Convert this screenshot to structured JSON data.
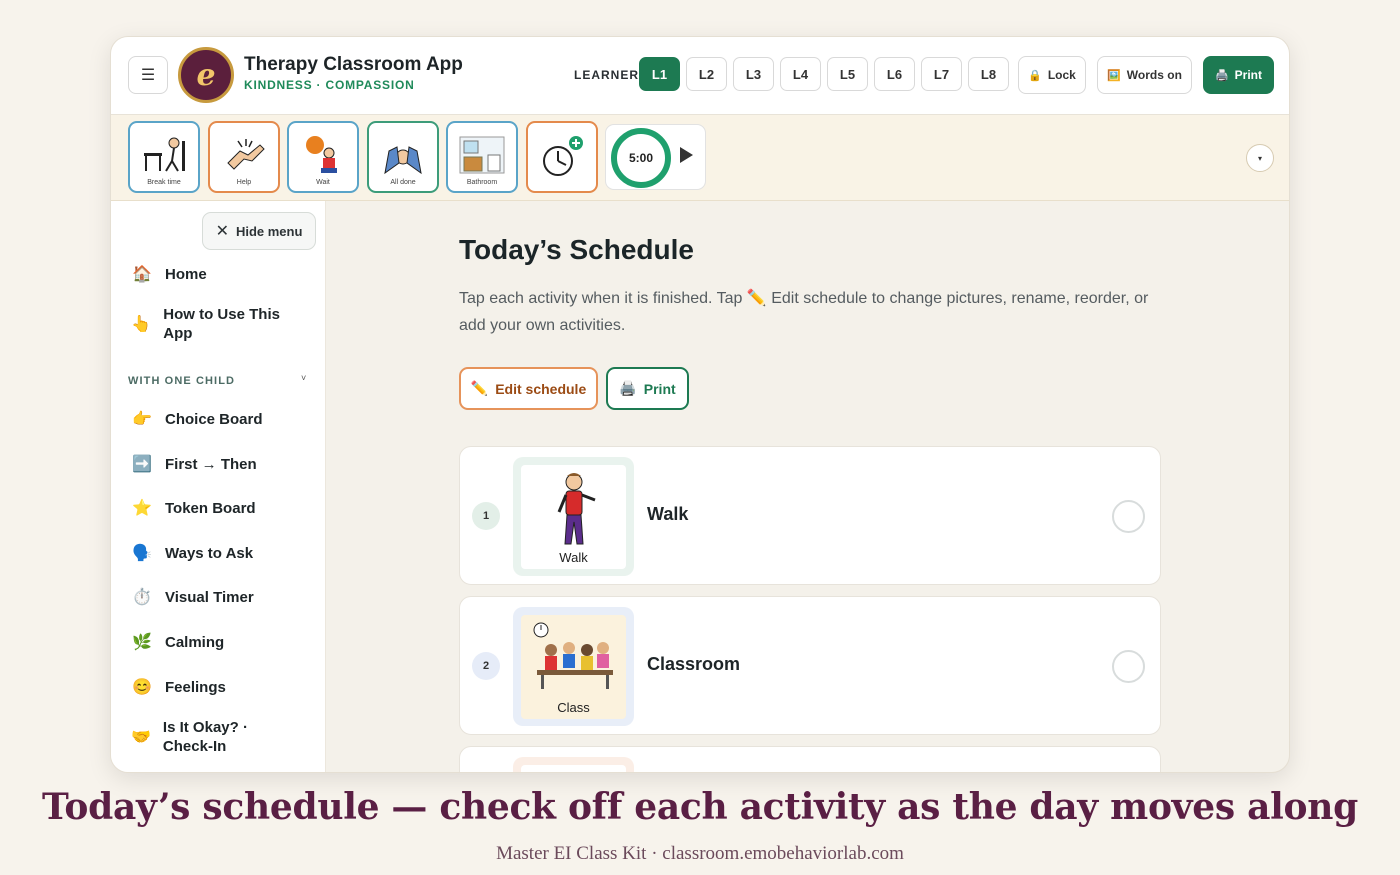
{
  "header": {
    "menu_icon": "hamburger-icon",
    "logo_letter": "e",
    "title": "Therapy Classroom App",
    "subtitle": "KINDNESS · COMPASSION",
    "learner_label": "LEARNER",
    "learners": [
      "L1",
      "L2",
      "L3",
      "L4",
      "L5",
      "L6",
      "L7",
      "L8"
    ],
    "active_learner": "L1",
    "lock_label": "Lock",
    "words_label": "Words on",
    "print_label": "Print",
    "colors": {
      "accent": "#1d7a52",
      "brand": "#5b1f3c"
    }
  },
  "quick_strip": {
    "tiles": [
      "Break time",
      "Help",
      "Wait",
      "All done",
      "Bathroom"
    ],
    "add_timer_icon": "clock-plus-icon",
    "timer_value": "5:00",
    "play_icon": "play-icon",
    "toggle_icon": "chevron-down-icon"
  },
  "sidebar": {
    "hide_menu": "Hide menu",
    "top_items": [
      {
        "icon": "🏠",
        "label": "Home"
      },
      {
        "icon": "👆",
        "label": "How to Use This App"
      }
    ],
    "section": "WITH ONE CHILD",
    "section_chevron": "˅",
    "items": [
      {
        "icon": "👉",
        "label": "Choice Board"
      },
      {
        "icon": "➡️",
        "label": "First → Then"
      },
      {
        "icon": "⭐",
        "label": "Token Board"
      },
      {
        "icon": "🗣️",
        "label": "Ways to Ask"
      },
      {
        "icon": "⏱️",
        "label": "Visual Timer"
      },
      {
        "icon": "🌿",
        "label": "Calming"
      },
      {
        "icon": "😊",
        "label": "Feelings"
      },
      {
        "icon": "🤝",
        "label": "Is It Okay? · Check-In"
      }
    ]
  },
  "main": {
    "title": "Today’s Schedule",
    "description": "Tap each activity when it is finished. Tap ✏️ Edit schedule to change pictures, rename, reorder, or add your own activities.",
    "edit_label": "Edit schedule",
    "print_label": "Print",
    "schedule": [
      {
        "num": "1",
        "pic_label": "Walk",
        "title": "Walk"
      },
      {
        "num": "2",
        "pic_label": "Class",
        "title": "Classroom"
      },
      {
        "num": "3",
        "pic_label": "",
        "title": ""
      }
    ]
  },
  "caption": "Today’s schedule — check off each activity as the day moves along",
  "footer": "Master EI Class Kit · classroom.emobehaviorlab.com"
}
